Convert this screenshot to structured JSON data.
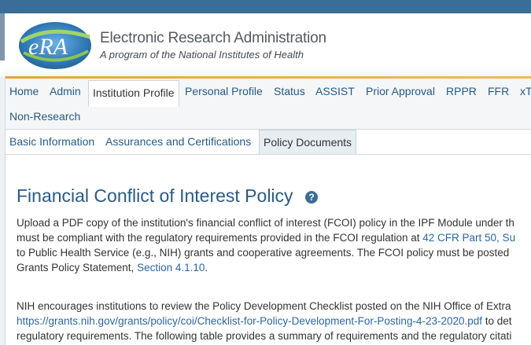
{
  "header": {
    "logo_text": "eRA",
    "title": "Electronic Research Administration",
    "subtitle": "A program of the National Institutes of Health"
  },
  "nav": {
    "items": [
      {
        "label": "Home"
      },
      {
        "label": "Admin"
      },
      {
        "label": "Institution Profile",
        "active": true
      },
      {
        "label": "Personal Profile"
      },
      {
        "label": "Status"
      },
      {
        "label": "ASSIST"
      },
      {
        "label": "Prior Approval"
      },
      {
        "label": "RPPR"
      },
      {
        "label": "FFR"
      },
      {
        "label": "xT"
      },
      {
        "label": "Non-Research"
      }
    ]
  },
  "subnav": {
    "items": [
      {
        "label": "Basic Information"
      },
      {
        "label": "Assurances and Certifications"
      },
      {
        "label": "Policy Documents",
        "active": true
      }
    ]
  },
  "main": {
    "title": "Financial Conflict of Interest Policy",
    "help_icon": "question-circle-icon",
    "para1": {
      "line1": "Upload a PDF copy of the institution's financial conflict of interest (FCOI) policy in the IPF Module under th",
      "line2_pre": "must be compliant with the regulatory requirements provided in the FCOI regulation at ",
      "line2_link1": "42 CFR Part 50, S",
      "line2_link2": "u",
      "line3": "to Public Health Service (e.g., NIH) grants and cooperative agreements. The FCOI policy must be posted",
      "line4_pre": "Grants Policy Statement, ",
      "line4_link": "Section 4.1.10",
      "line4_post": "."
    },
    "para2": {
      "line1": "NIH encourages institutions to review the Policy Development Checklist posted on the NIH Office of Extra",
      "line2_link": "https://grants.nih.gov/grants/policy/coi/Checklist-for-Policy-Development-For-Posting-4-23-2020.pdf",
      "line2_post": " to det",
      "line3": "regulatory requirements. The following table provides a summary of requirements and the regulatory citati"
    }
  },
  "colors": {
    "brand_blue": "#3a6e98",
    "link": "#2a66a8",
    "accent_orange": "#e8a43c"
  }
}
